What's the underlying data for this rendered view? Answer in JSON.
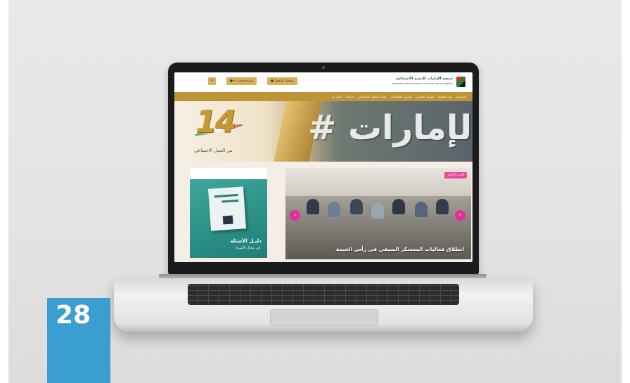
{
  "page_number": "28",
  "site": {
    "logo_ar": "جمعية الإمارات للتنمية الاجتماعية",
    "logo_en": "EMIRATES ASSOCIATION FOR SOCIAL DEVELOPMENT",
    "login_label": "تسجيل الدخول",
    "register_label": "إنشاء حساب",
    "search_icon": "search-icon",
    "nav": [
      "الرئيسية",
      "عن الجمعية",
      "المركز الإعلامي",
      "الفرص والفعاليات",
      "جائزة التمكين الاجتماعي",
      "خدماتنا",
      "اتصل بنا"
    ],
    "banner": {
      "number": "14",
      "subtitle": "من العمل الاجتماعي",
      "hashtag": "# جمعية الإمارات"
    },
    "book": {
      "title": "دليـل الأسئلة",
      "subtitle": "في مجال الأسرة"
    },
    "news": {
      "badge": "أحدث الأخبار",
      "title": "انطلاق فعاليات المعسكر الصيفي في رأس الخيمة",
      "prev": "‹",
      "next": "›"
    }
  },
  "colors": {
    "gold": "#bd9538",
    "accent_pink": "#e52d9a",
    "page_box": "#3a9fd0"
  }
}
